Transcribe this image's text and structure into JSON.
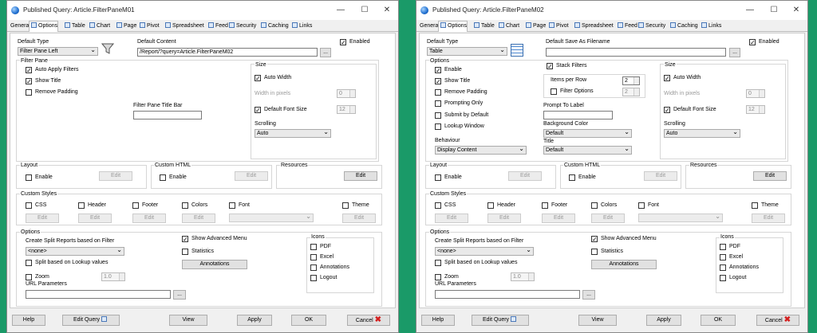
{
  "window_controls": {
    "minimize": "—",
    "maximize": "☐",
    "close": "✕"
  },
  "tabs": [
    "General",
    "Options",
    "Table",
    "Chart",
    "Page",
    "Pivot",
    "Spreadsheet",
    "Feed",
    "Security",
    "Caching",
    "Links"
  ],
  "bottom": {
    "help": "Help",
    "edit_query": "Edit Query",
    "view": "View",
    "apply": "Apply",
    "ok": "OK",
    "cancel": "Cancel"
  },
  "colors": {
    "background": "#1a9a68",
    "cancel_icon": "#d42020"
  },
  "w1": {
    "title": "Published Query: Article.FilterPaneM01",
    "default_type_label": "Default Type",
    "default_type_value": "Filter Pane Left",
    "default_content_label": "Default Content",
    "default_content_value": "/Report/?query=Article.FilterPaneM02",
    "browse_btn": "...",
    "enabled": "Enabled",
    "filter_pane": "Filter Pane",
    "auto_apply": "Auto Apply Filters",
    "show_title": "Show Title",
    "remove_padding": "Remove Padding",
    "title_bar_label": "Filter Pane Title Bar",
    "size": "Size",
    "auto_width": "Auto Width",
    "width_pixels": "Width in pixels",
    "width_value": "0",
    "default_font_size": "Default Font Size",
    "font_size_value": "12",
    "scrolling": "Scrolling",
    "scrolling_value": "Auto",
    "layout": "Layout",
    "enable": "Enable",
    "edit": "Edit",
    "custom_html": "Custom HTML",
    "resources": "Resources",
    "custom_styles": "Custom Styles",
    "css": "CSS",
    "header": "Header",
    "footer": "Footer",
    "colors": "Colors",
    "font": "Font",
    "theme": "Theme",
    "options": "Options",
    "split_label": "Create Split Reports based on Filter",
    "split_value": "<none>",
    "split_lookup": "Split based on Lookup values",
    "zoom": "Zoom",
    "zoom_value": "1.0",
    "url_params": "URL Parameters",
    "show_adv_menu": "Show Advanced Menu",
    "statistics": "Statistics",
    "annotations_btn": "Annotations",
    "icons": "Icons",
    "pdf": "PDF",
    "excel": "Excel",
    "annotations": "Annotations",
    "logout": "Logout"
  },
  "w2": {
    "title": "Published Query: Article.FilterPaneM02",
    "default_type_label": "Default Type",
    "default_type_value": "Table",
    "default_save_label": "Default Save As Filename",
    "browse_btn": "...",
    "enabled": "Enabled",
    "options_grp": "Options",
    "enable": "Enable",
    "show_title": "Show Title",
    "remove_padding": "Remove Padding",
    "prompting_only": "Prompting Only",
    "submit_default": "Submit by Default",
    "lookup_window": "Lookup Window",
    "behaviour": "Behaviour",
    "behaviour_value": "Display Content",
    "stack_filters": "Stack Filters",
    "items_per_row": "Items per Row",
    "items_value": "2",
    "filter_options": "Filter Options",
    "filter_options_value": "2",
    "prompt_label": "Prompt To Label",
    "bg_color": "Background Color",
    "bg_value": "Default",
    "title_lbl": "Title",
    "title_value": "Default",
    "size": "Size",
    "auto_width": "Auto Width",
    "width_pixels": "Width in pixels",
    "width_value": "0",
    "default_font_size": "Default Font Size",
    "font_size_value": "12",
    "scrolling": "Scrolling",
    "scrolling_value": "Auto",
    "layout": "Layout",
    "edit": "Edit",
    "custom_html": "Custom HTML",
    "resources": "Resources",
    "custom_styles": "Custom Styles",
    "css": "CSS",
    "header": "Header",
    "footer": "Footer",
    "colors": "Colors",
    "font": "Font",
    "theme": "Theme",
    "options": "Options",
    "split_label": "Create Split Reports based on Filter",
    "split_value": "<none>",
    "split_lookup": "Split based on Lookup values",
    "zoom": "Zoom",
    "zoom_value": "1.0",
    "url_params": "URL Parameters",
    "show_adv_menu": "Show Advanced Menu",
    "statistics": "Statistics",
    "annotations_btn": "Annotations",
    "icons": "Icons",
    "pdf": "PDF",
    "excel": "Excel",
    "annotations": "Annotations",
    "logout": "Logout"
  }
}
